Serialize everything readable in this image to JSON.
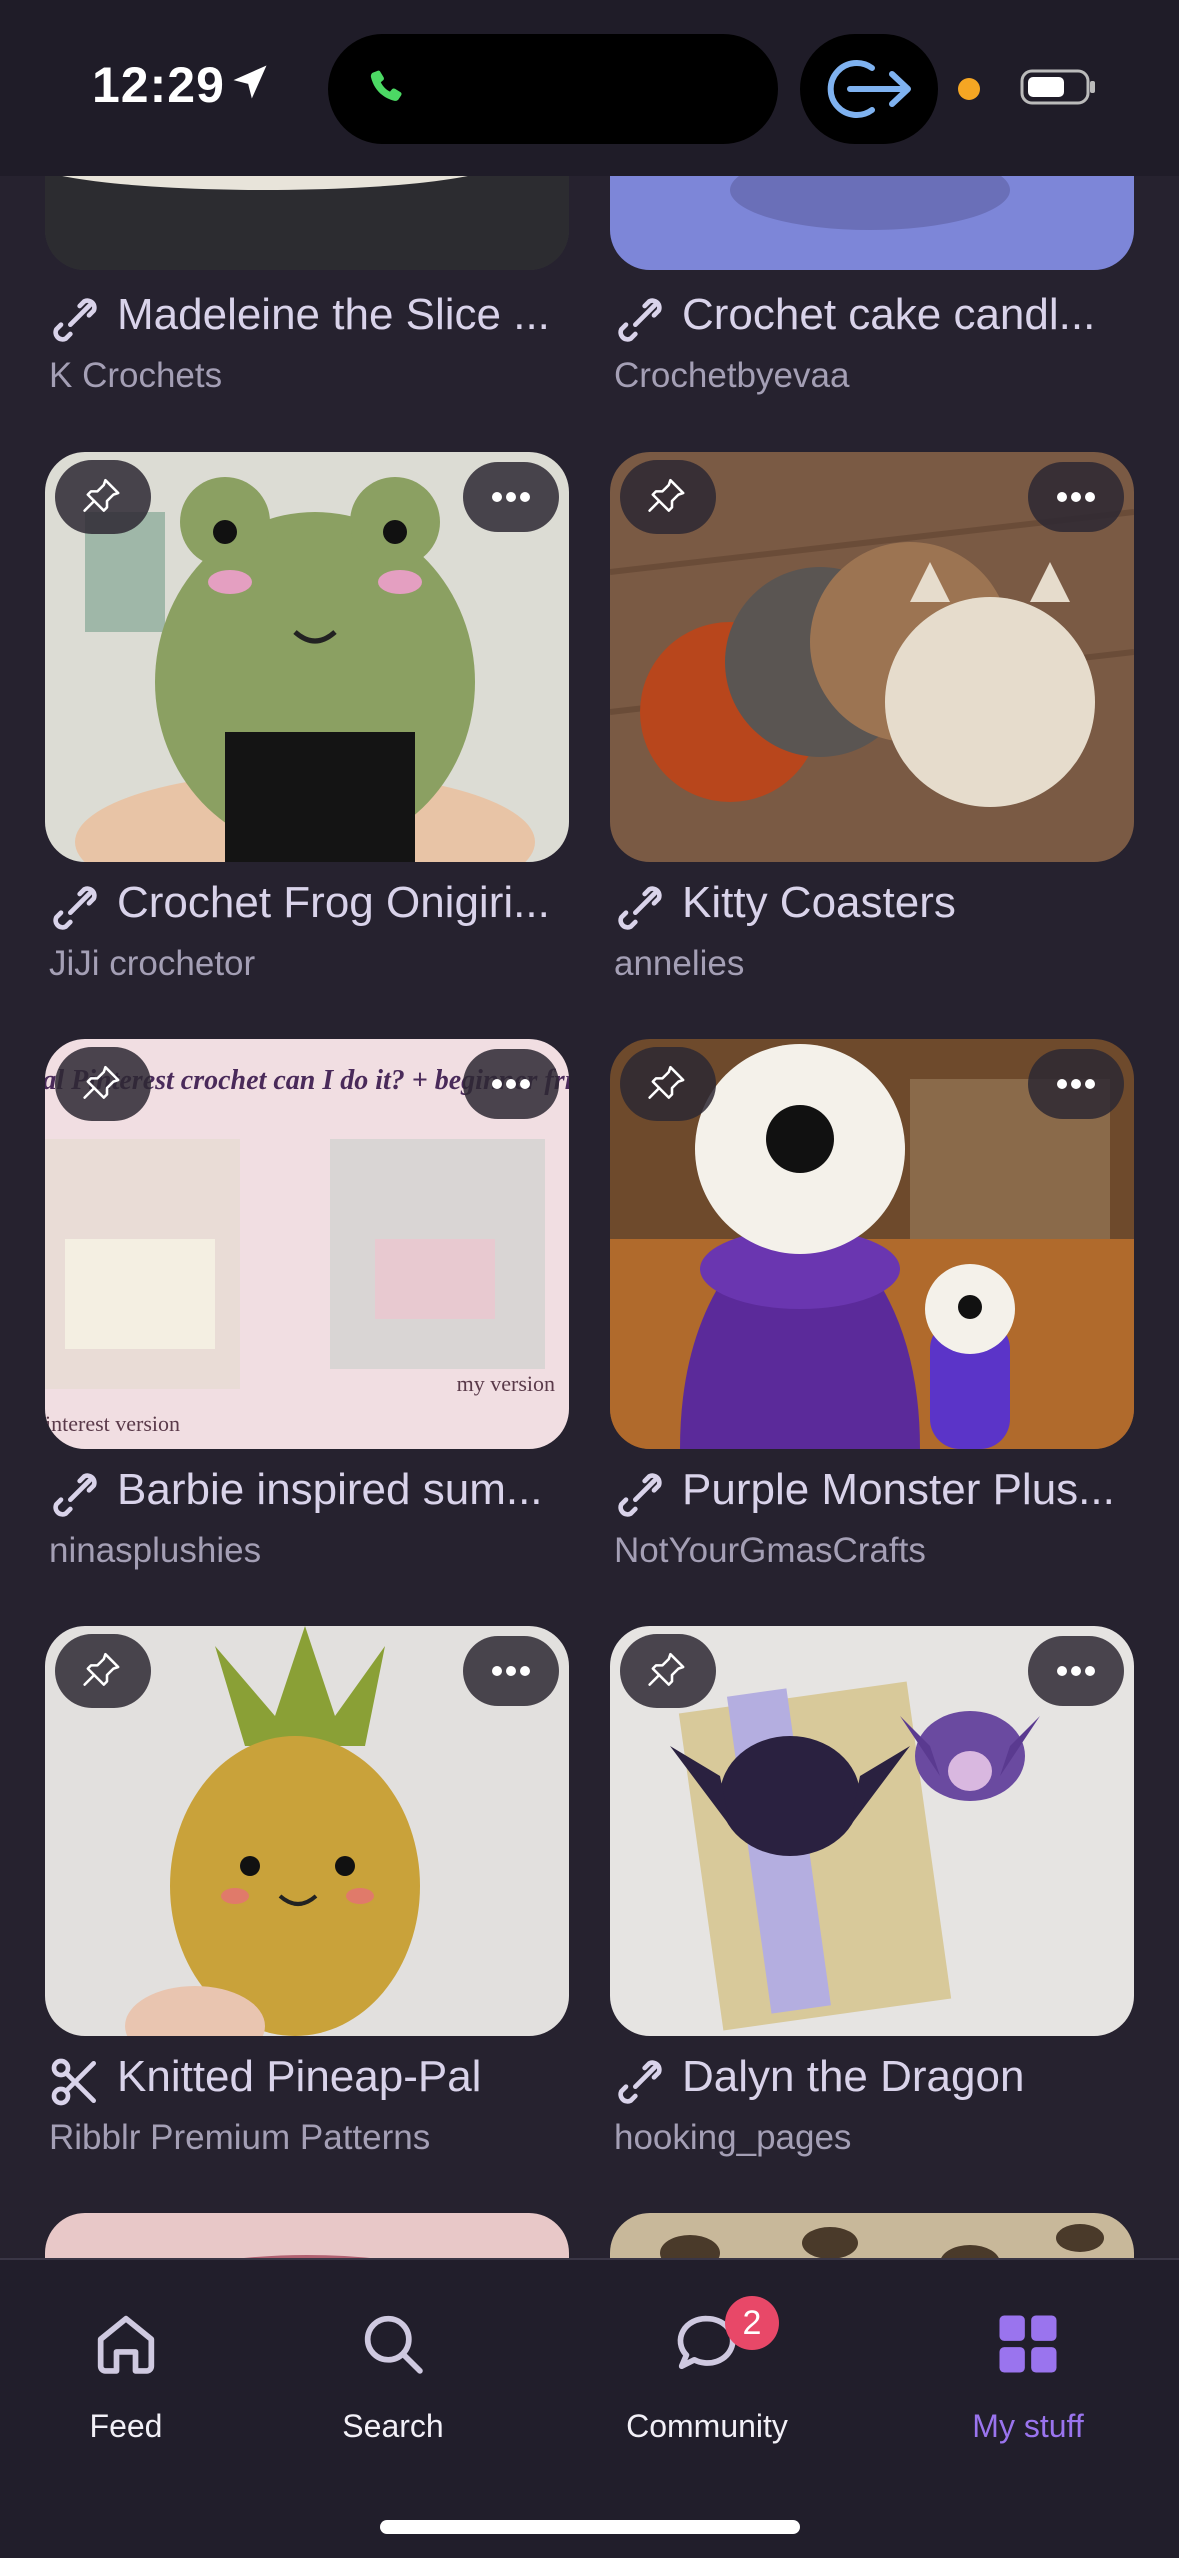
{
  "status": {
    "time": "12:29"
  },
  "patterns": [
    {
      "title": "Madeleine the Slice ...",
      "author": "K Crochets",
      "icon": "link-icon"
    },
    {
      "title": "Crochet cake candl...",
      "author": "Crochetbyevaa",
      "icon": "link-icon"
    },
    {
      "title": "Crochet Frog Onigiri...",
      "author": "JiJi crochetor",
      "icon": "link-icon"
    },
    {
      "title": "Kitty Coasters",
      "author": "annelies",
      "icon": "link-icon"
    },
    {
      "title": "Barbie inspired sum...",
      "author": "ninasplushies",
      "icon": "link-icon"
    },
    {
      "title": "Purple Monster Plus...",
      "author": "NotYourGmasCrafts",
      "icon": "link-icon"
    },
    {
      "title": "Knitted Pineap-Pal",
      "author": "Ribblr Premium Patterns",
      "icon": "scissors-icon"
    },
    {
      "title": "Dalyn the Dragon",
      "author": "hooking_pages",
      "icon": "link-icon"
    }
  ],
  "barbie_thumb": {
    "banner": "trying this viral Pinterest crochet can I do it? + beginner friendly tutorial",
    "left_caption": "interest version",
    "right_caption": "my version"
  },
  "tabbar": {
    "feed": "Feed",
    "search": "Search",
    "community": "Community",
    "community_badge": "2",
    "mystuff": "My stuff"
  },
  "colors": {
    "background": "#26222f",
    "accent": "#9a74ee",
    "badge": "#e84868"
  }
}
